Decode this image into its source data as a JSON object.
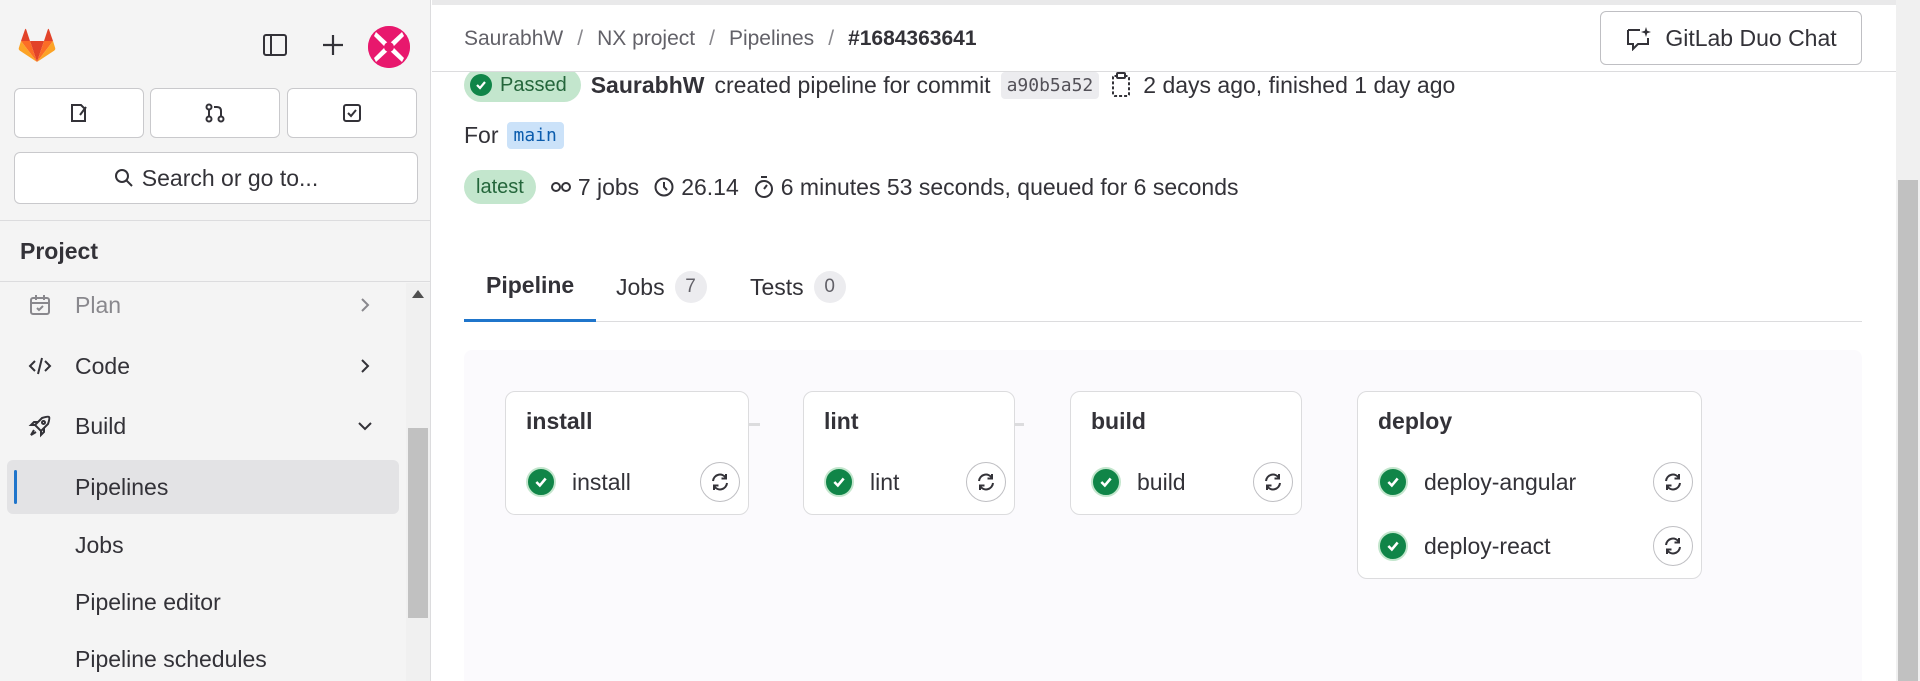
{
  "sidebar": {
    "search_label": "Search or go to...",
    "section_title": "Project",
    "nav": [
      {
        "label": "Plan"
      },
      {
        "label": "Code"
      },
      {
        "label": "Build"
      }
    ],
    "build_items": [
      {
        "label": "Pipelines"
      },
      {
        "label": "Jobs"
      },
      {
        "label": "Pipeline editor"
      },
      {
        "label": "Pipeline schedules"
      }
    ]
  },
  "header": {
    "breadcrumb": [
      "SaurabhW",
      "NX project",
      "Pipelines",
      "#1684363641"
    ],
    "duo_chat_label": "GitLab Duo Chat"
  },
  "pipeline": {
    "status": "Passed",
    "author": "SaurabhW",
    "created_text": "created pipeline for commit",
    "commit_sha": "a90b5a52",
    "time_text": "2 days ago, finished 1 day ago",
    "for_label": "For",
    "branch": "main",
    "latest_label": "latest",
    "jobs_count_text": "7 jobs",
    "compute_minutes": "26.14",
    "duration_text": "6 minutes 53 seconds, queued for 6 seconds"
  },
  "tabs": [
    {
      "label": "Pipeline"
    },
    {
      "label": "Jobs",
      "count": "7"
    },
    {
      "label": "Tests",
      "count": "0"
    }
  ],
  "stages": [
    {
      "name": "install",
      "jobs": [
        "install"
      ]
    },
    {
      "name": "lint",
      "jobs": [
        "lint"
      ]
    },
    {
      "name": "build",
      "jobs": [
        "build"
      ]
    },
    {
      "name": "deploy",
      "jobs": [
        "deploy-angular",
        "deploy-react"
      ]
    }
  ],
  "colors": {
    "success": "#108548",
    "accent": "#1f75cb",
    "brand": "#fc6d26"
  }
}
